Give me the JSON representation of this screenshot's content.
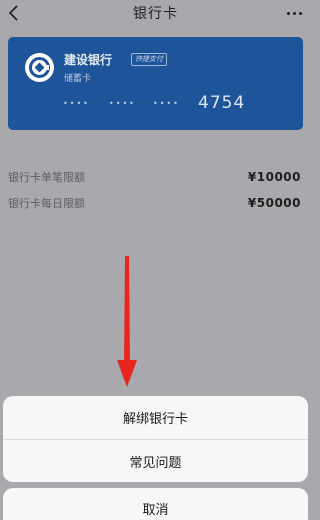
{
  "nav": {
    "title": "银行卡",
    "back_icon": "chevron-left-icon",
    "more_icon": "ellipsis-icon"
  },
  "card": {
    "bank_name": "建设银行",
    "badge": "快捷支付",
    "card_type": "储蓄卡",
    "masked_groups": [
      "••••",
      "••••",
      "••••"
    ],
    "last_four": "4754",
    "color": "#1e549a",
    "logo_icon": "ccb-bank-logo-icon"
  },
  "limits": [
    {
      "label": "银行卡单笔限额",
      "value": "¥10000"
    },
    {
      "label": "银行卡每日限额",
      "value": "¥50000"
    }
  ],
  "sheet": {
    "items": [
      "解绑银行卡",
      "常见问题"
    ],
    "cancel": "取消"
  },
  "annotation": {
    "arrow_icon": "red-arrow-down-icon",
    "color": "#e8251f"
  }
}
